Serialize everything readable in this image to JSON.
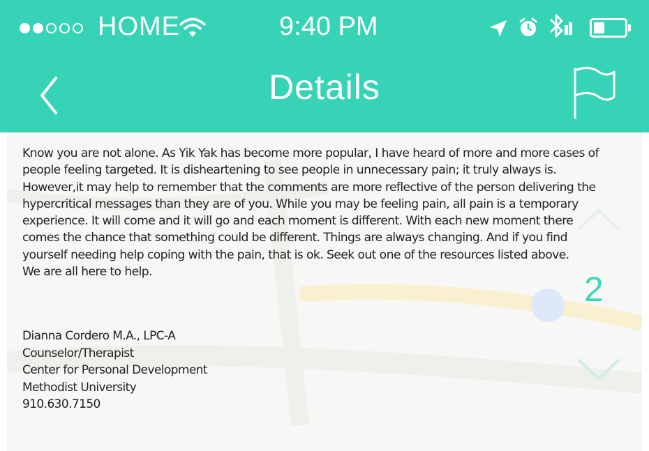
{
  "status_bar": {
    "signal_dots": [
      true,
      true,
      false,
      false,
      false
    ],
    "carrier": "HOME",
    "time": "9:40 PM",
    "icons": [
      "wifi-icon",
      "location-icon",
      "alarm-icon",
      "bluetooth-icon",
      "battery-icon"
    ],
    "battery_level": 0.35
  },
  "nav": {
    "title": "Details",
    "back_icon": "chevron-left-icon",
    "flag_icon": "flag-icon"
  },
  "post": {
    "message_lines": [
      "Know you are not alone. As Yik Yak has become more popular, I have heard of more and more cases of",
      "people feeling targeted. It is disheartening to see people in unnecessary pain; it truly always is.",
      "However,it may help to remember that the comments are more reflective of the person delivering the",
      "hypercritical messages than they are of you. While you may be feeling pain, all pain is a temporary",
      " experience. It will come and it will go and each moment is different. With each new moment there",
      "comes the chance that something could be different. Things are always changing. And if you find",
      "yourself needing help coping with the pain, that is ok. Seek out one of the resources listed above.",
      "We are all here to help."
    ],
    "signature_lines": [
      "Dianna Cordero M.A., LPC-A",
      "Counselor/Therapist",
      "Center for Personal Development",
      "Methodist University",
      "910.630.7150"
    ],
    "vote_count": "2"
  },
  "colors": {
    "accent": "#37d3b6",
    "vote": "#3fd6bb"
  }
}
